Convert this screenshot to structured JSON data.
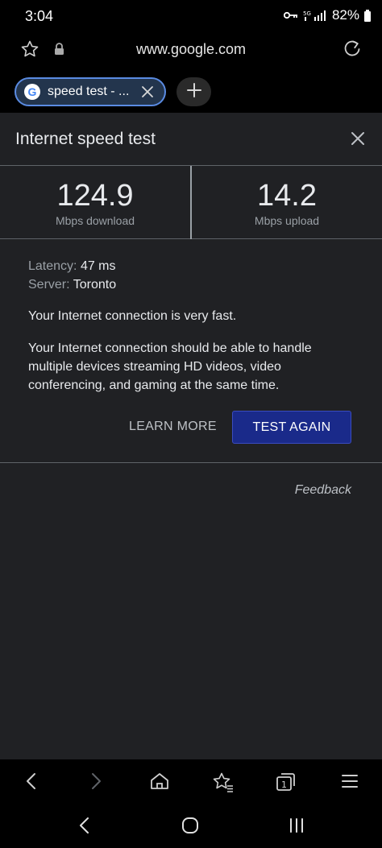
{
  "status_bar": {
    "time": "3:04",
    "battery": "82%"
  },
  "address_bar": {
    "url": "www.google.com"
  },
  "tab": {
    "logo_letter": "G",
    "label": "speed test - ..."
  },
  "speed_test": {
    "title": "Internet speed test",
    "download": {
      "value": "124.9",
      "unit": "Mbps download"
    },
    "upload": {
      "value": "14.2",
      "unit": "Mbps upload"
    },
    "latency_label": "Latency:",
    "latency_value": "47 ms",
    "server_label": "Server:",
    "server_value": "Toronto",
    "summary": "Your Internet connection is very fast.",
    "description": "Your Internet connection should be able to handle multiple devices streaming HD videos, video conferencing, and gaming at the same time.",
    "learn_more": "LEARN MORE",
    "test_again": "TEST AGAIN",
    "feedback": "Feedback"
  },
  "toolbar": {
    "tab_count": "1"
  },
  "colors": {
    "background": "#202124",
    "button_primary": "#1a2a8a",
    "tab_border": "#5a8be2"
  }
}
